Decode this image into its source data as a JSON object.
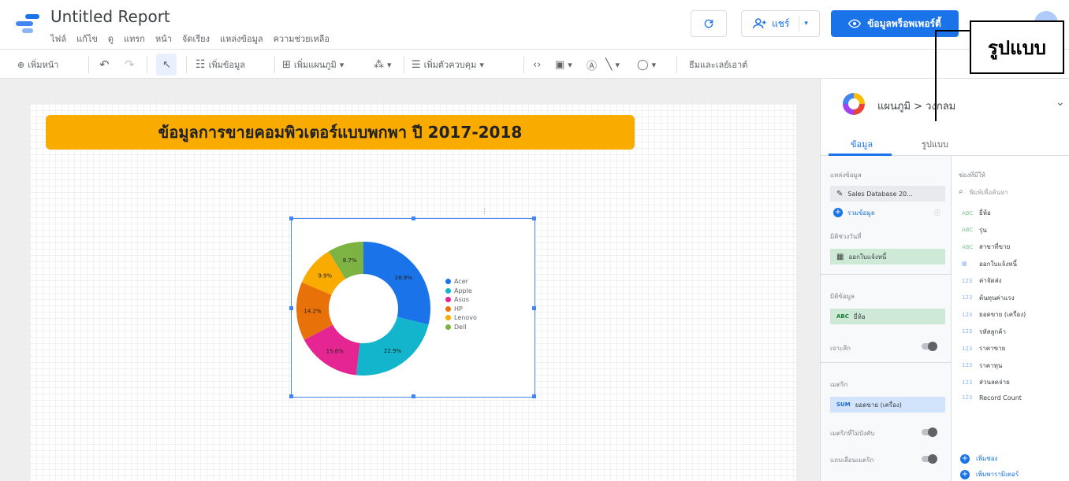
{
  "header": {
    "report_title": "Untitled Report",
    "menu": [
      "ไฟล์",
      "แก้ไข",
      "ดู",
      "แทรก",
      "หน้า",
      "จัดเรียง",
      "แหล่งข้อมูล",
      "ความช่วยเหลือ"
    ],
    "refresh_icon": "refresh-icon",
    "share_label": "แชร์",
    "view_label": "ข้อมูลพร็อพเพอร์ตี้"
  },
  "callout": {
    "text": "รูปแบบ"
  },
  "toolbar": {
    "add_page": "เพิ่มหน้า",
    "add_data": "เพิ่มข้อมูล",
    "add_chart": "เพิ่มแผนภูมิ",
    "add_control": "เพิ่มตัวควบคุม",
    "theme_layout": "ธีมและเลย์เอาต์"
  },
  "canvas": {
    "title": "ข้อมูลการขายคอมพิวเตอร์แบบพกพา ปี 2017-2018"
  },
  "chart_data": {
    "type": "pie",
    "donut": true,
    "categories": [
      "Acer",
      "Apple",
      "Asus",
      "HP",
      "Lenovo",
      "Dell"
    ],
    "values": [
      28.9,
      22.9,
      15.6,
      14.2,
      9.9,
      8.7
    ],
    "value_labels": [
      "28.9%",
      "22.9%",
      "15.6%",
      "14.2%",
      "9.9%",
      "8.7%"
    ],
    "colors": [
      "#1a73e8",
      "#12b5cb",
      "#e52592",
      "#e8710a",
      "#f9ab00",
      "#7cb342"
    ],
    "legend_position": "right"
  },
  "panel": {
    "chart_type_label": "แผนภูมิ > วงกลม",
    "tabs": [
      "ข้อมูล",
      "รูปแบบ"
    ],
    "data_source_label": "แหล่งข้อมูล",
    "data_source_value": "Sales Database 20...",
    "blend_label": "รวมข้อมูล",
    "date_range_dim_label": "มิติช่วงวันที่",
    "date_range_dim_value": "ออกใบแจ้งหนี้",
    "dimension_label": "มิติข้อมูล",
    "dimension_value": "ยี่ห้อ",
    "drilldown_label": "เจาะลึก",
    "metric_label": "เมตริก",
    "metric_badge": "SUM",
    "metric_value": "ยอดขาย (เครื่อง)",
    "optional_metrics_label": "เมตริกที่ไม่บังคับ",
    "metric_slider_label": "แถบเลื่อนเมตริก",
    "available_fields_label": "ช่องที่มีให้",
    "search_placeholder": "พิมพ์เพื่อค้นหา",
    "fields": [
      {
        "type": "ABC",
        "name": "ยี่ห้อ"
      },
      {
        "type": "ABC",
        "name": "รุ่น"
      },
      {
        "type": "ABC",
        "name": "สาขาที่ขาย"
      },
      {
        "type": "DATE",
        "name": "ออกใบแจ้งหนี้"
      },
      {
        "type": "123",
        "name": "ค่าจัดส่ง"
      },
      {
        "type": "123",
        "name": "ต้นทุนค่าแรง"
      },
      {
        "type": "123",
        "name": "ยอดขาย (เครื่อง)"
      },
      {
        "type": "123",
        "name": "รหัสลูกค้า"
      },
      {
        "type": "123",
        "name": "ราคาขาย"
      },
      {
        "type": "123",
        "name": "ราคาทุน"
      },
      {
        "type": "123",
        "name": "ส่วนลดจ่าย"
      },
      {
        "type": "123",
        "name": "Record Count"
      }
    ],
    "add_field_label": "เพิ่มช่อง",
    "add_param_label": "เพิ่มพารามิเตอร์"
  }
}
